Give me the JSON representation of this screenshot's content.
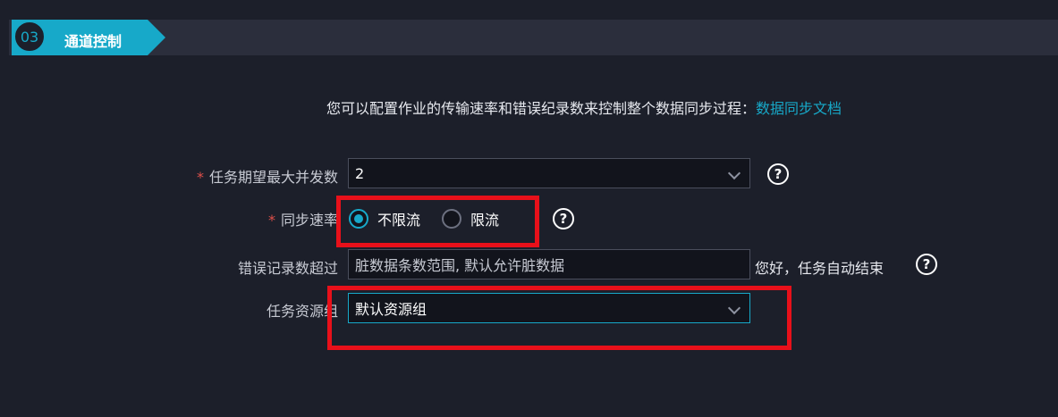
{
  "section": {
    "step_number": "03",
    "title": "通道控制"
  },
  "intro": {
    "text": "您可以配置作业的传输速率和错误纪录数来控制整个数据同步过程：",
    "link": "数据同步文档"
  },
  "form": {
    "max_concurrency": {
      "required_mark": "*",
      "label": "任务期望最大并发数",
      "value": "2"
    },
    "sync_rate": {
      "required_mark": "*",
      "label": "同步速率",
      "options": [
        {
          "label": "不限流",
          "selected": true
        },
        {
          "label": "限流",
          "selected": false
        }
      ]
    },
    "error_records": {
      "label": "错误记录数超过",
      "placeholder": "脏数据条数范围, 默认允许脏数据",
      "suffix": "您好，任务自动结束"
    },
    "resource_group": {
      "label": "任务资源组",
      "value": "默认资源组"
    }
  },
  "help_glyph": "?",
  "colors": {
    "accent": "#17a9c9",
    "background": "#1c1f2a",
    "highlight": "#e8101a",
    "required": "#e0504a"
  }
}
